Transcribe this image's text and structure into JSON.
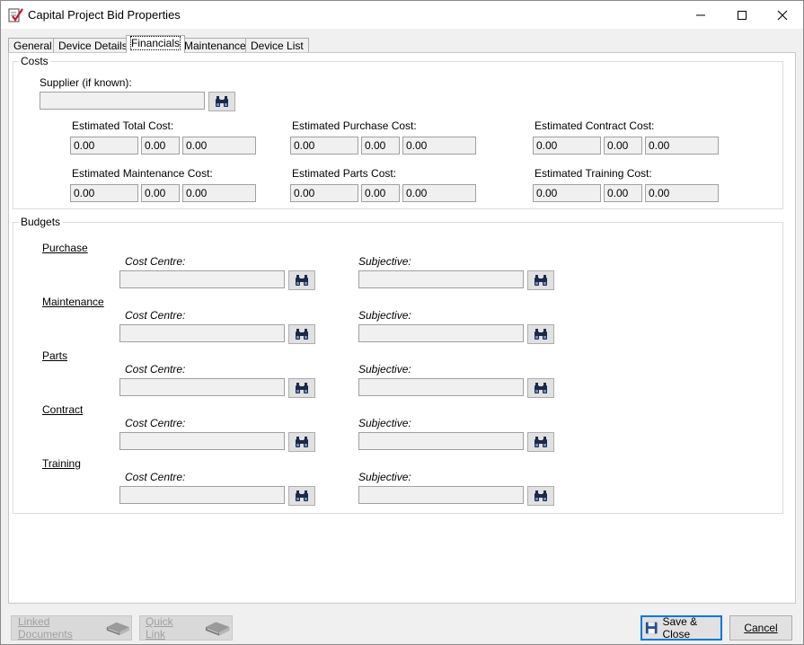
{
  "window": {
    "title": "Capital Project Bid Properties"
  },
  "tabs": [
    {
      "label": "General"
    },
    {
      "label": "Device Details"
    },
    {
      "label": "Financials"
    },
    {
      "label": "Maintenance"
    },
    {
      "label": "Device List"
    }
  ],
  "active_tab": "Financials",
  "costs": {
    "group_title": "Costs",
    "supplier_label": "Supplier (if known):",
    "supplier_value": "",
    "fields": [
      {
        "label": "Estimated Total Cost:",
        "values": [
          "0.00",
          "0.00",
          "0.00"
        ]
      },
      {
        "label": "Estimated Purchase Cost:",
        "values": [
          "0.00",
          "0.00",
          "0.00"
        ]
      },
      {
        "label": "Estimated Contract Cost:",
        "values": [
          "0.00",
          "0.00",
          "0.00"
        ]
      },
      {
        "label": "Estimated Maintenance Cost:",
        "values": [
          "0.00",
          "0.00",
          "0.00"
        ]
      },
      {
        "label": "Estimated Parts Cost:",
        "values": [
          "0.00",
          "0.00",
          "0.00"
        ]
      },
      {
        "label": "Estimated Training Cost:",
        "values": [
          "0.00",
          "0.00",
          "0.00"
        ]
      }
    ]
  },
  "budgets": {
    "group_title": "Budgets",
    "cost_centre_label": "Cost Centre:",
    "subjective_label": "Subjective:",
    "sections": [
      {
        "title": "Purchase",
        "cost_centre": "",
        "subjective": ""
      },
      {
        "title": "Maintenance",
        "cost_centre": "",
        "subjective": ""
      },
      {
        "title": "Parts",
        "cost_centre": "",
        "subjective": ""
      },
      {
        "title": "Contract",
        "cost_centre": "",
        "subjective": ""
      },
      {
        "title": "Training",
        "cost_centre": "",
        "subjective": ""
      }
    ]
  },
  "footer": {
    "linked_documents": "Linked Documents",
    "quick_link": "Quick Link",
    "save_close": "Save & Close",
    "cancel": "Cancel"
  },
  "icons": {
    "lookup": "binoculars-icon",
    "linked": "book-icon",
    "save": "floppy-disk-icon"
  }
}
